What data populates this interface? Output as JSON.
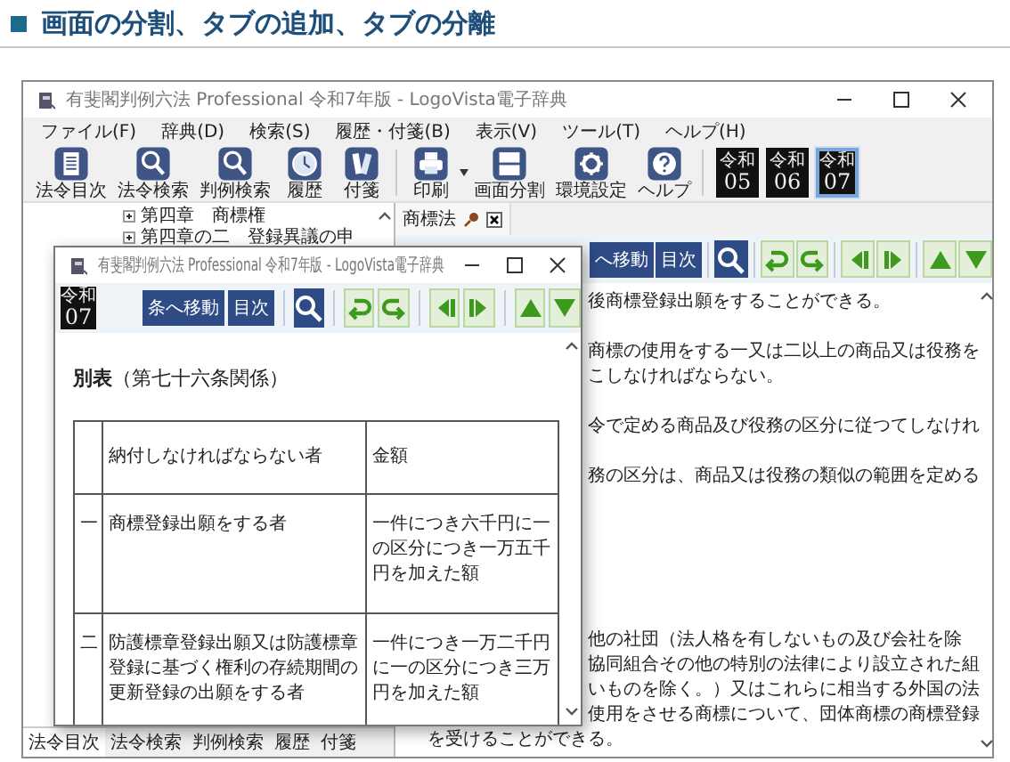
{
  "page_heading": "画面の分割、タブの追加、タブの分離",
  "main_window": {
    "title": "有斐閣判例六法 Professional 令和7年版 - LogoVista電子辞典",
    "menu": [
      "ファイル(F)",
      "辞典(D)",
      "検索(S)",
      "履歴・付箋(B)",
      "表示(V)",
      "ツール(T)",
      "ヘルプ(H)"
    ],
    "toolbar": [
      {
        "label": "法令目次",
        "kind": "list"
      },
      {
        "label": "法令検索",
        "kind": "search"
      },
      {
        "label": "判例検索",
        "kind": "search"
      },
      {
        "label": "履歴",
        "kind": "clock"
      },
      {
        "label": "付箋",
        "kind": "tag"
      },
      {
        "label": "印刷",
        "kind": "printer"
      },
      {
        "label": "画面分割",
        "kind": "split"
      },
      {
        "label": "環境設定",
        "kind": "gear"
      },
      {
        "label": "ヘルプ",
        "kind": "help"
      }
    ],
    "era_buttons": [
      {
        "era": "令和",
        "year": "05",
        "selected": false
      },
      {
        "era": "令和",
        "year": "06",
        "selected": false
      },
      {
        "era": "令和",
        "year": "07",
        "selected": true
      }
    ],
    "left_pane": {
      "tree": [
        {
          "label": "第四章　商標権",
          "expanded": false
        },
        {
          "label": "第四章の二　登録異議の申",
          "expanded": false
        }
      ],
      "tabs": [
        {
          "label": "法令目次",
          "selected": true
        },
        {
          "label": "法令検索",
          "selected": false
        },
        {
          "label": "判例検索",
          "selected": false
        },
        {
          "label": "履歴",
          "selected": false
        },
        {
          "label": "付箋",
          "selected": false
        }
      ]
    },
    "right_pane": {
      "tab": "商標法",
      "buttons": [
        "へ移動",
        "目次"
      ],
      "paragraphs": [
        [
          "後商標登録出願をすることができる。"
        ],
        [
          "商標の使用をする一又は二以上の商品又は役務を",
          "こしなければならない。"
        ],
        [
          "令で定める商品及び役務の区分に従つてしなけれ"
        ],
        [
          "務の区分は、商品又は役務の類似の範囲を定める"
        ],
        [
          "他の社団（法人格を有しないもの及び会社を除",
          "協同組合その他の特別の法律により設立された組",
          "いものを除く。）又はこれらに相当する外国の法",
          "使用をさせる商標について、団体商標の商標登録",
          "を受けることができる。"
        ]
      ]
    }
  },
  "sub_window": {
    "title": "有斐閣判例六法 Professional 令和7年版 - LogoVista電子辞典",
    "era": {
      "era": "令和",
      "year": "07"
    },
    "buttons": [
      "条へ移動",
      "目次"
    ],
    "heading": "**別表**（第七十六条関係）",
    "table": {
      "columns": [
        "納付しなければならない者",
        "金額"
      ],
      "rows": [
        {
          "number": "一",
          "payer": "商標登録出願をする者",
          "amount": "一件につき六千円に一の区分につき一万五千円を加えた額"
        },
        {
          "number": "二",
          "payer": "防護標章登録出願又は防護標章登録に基づく権利の存続期間の更新登録の出願をする者",
          "amount": "一件につき一万二千円に一の区分につき三万円を加えた額"
        }
      ]
    }
  }
}
